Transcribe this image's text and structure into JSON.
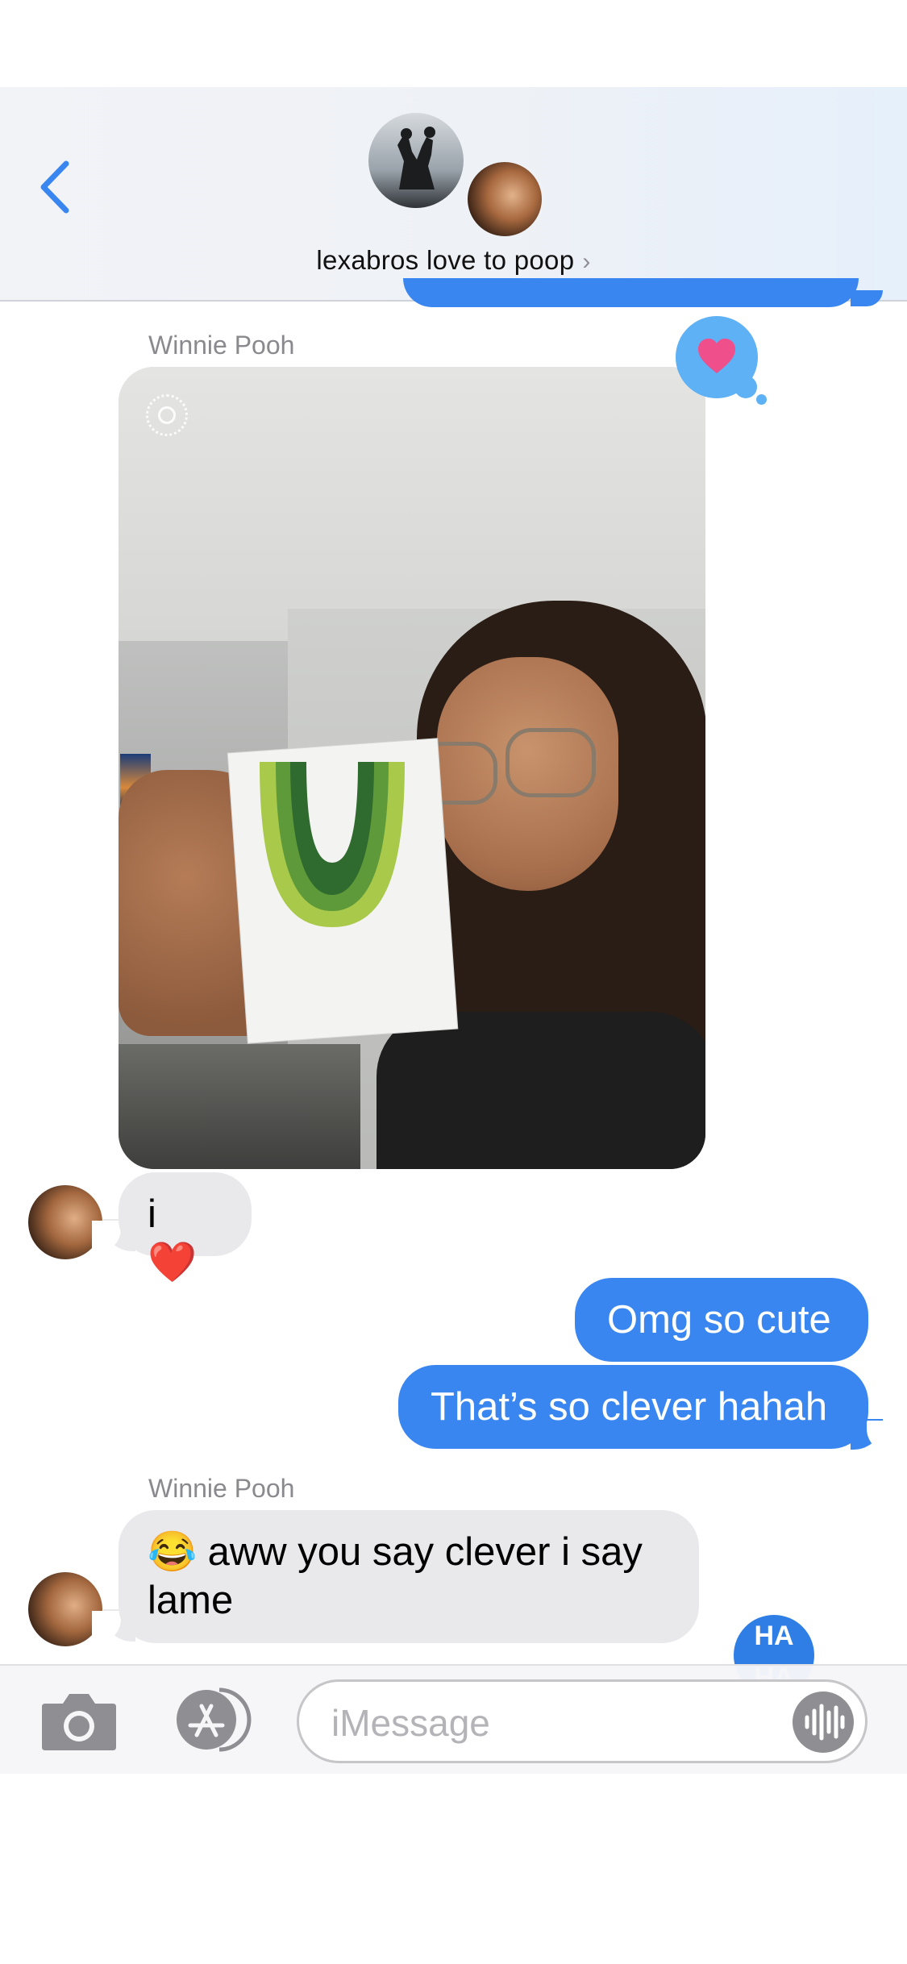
{
  "header": {
    "back_icon": "chevron-left-icon",
    "conversation_title": "lexabros love to poop",
    "title_chevron": "›",
    "accent": "#3a86f0"
  },
  "messages": {
    "photo_sender": "Winnie Pooh",
    "photo_tapback": "heart",
    "reply_text": "i ❤️",
    "outgoing_1": "Omg so cute",
    "outgoing_2": "That’s so clever hahah",
    "last_sender": "Winnie Pooh",
    "last_line_1": "😂 aww you say clever i say",
    "last_line_2": "lame",
    "last_tapback": "HA HA"
  },
  "composer": {
    "placeholder": "iMessage",
    "camera_icon": "camera-icon",
    "appstore_icon": "app-store-icon",
    "audio_icon": "waveform-icon"
  },
  "colors": {
    "incoming_bubble": "#e9e9eb",
    "outgoing_bubble": "#3a86f0",
    "tapback": "#5db1f4",
    "heart": "#ef4f8a"
  }
}
